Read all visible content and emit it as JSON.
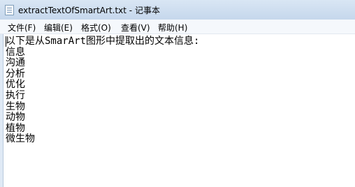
{
  "window": {
    "title": "extractTextOfSmartArt.txt - 记事本"
  },
  "menubar": {
    "items": [
      {
        "label": "文件(F)"
      },
      {
        "label": "编辑(E)"
      },
      {
        "label": "格式(O)"
      },
      {
        "label": "查看(V)"
      },
      {
        "label": "帮助(H)"
      }
    ]
  },
  "editor": {
    "lines": [
      "以下是从SmarArt图形中提取出的文本信息:",
      "信息",
      "沟通",
      "分析",
      "优化",
      "执行",
      "生物",
      "动物",
      "植物",
      "微生物"
    ]
  }
}
